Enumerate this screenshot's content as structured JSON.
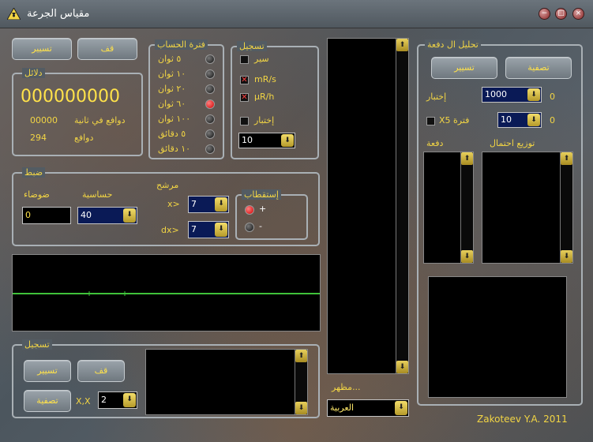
{
  "window": {
    "title": "مقياس الجرعة",
    "min": "−",
    "max": "□",
    "close": "×"
  },
  "top": {
    "reset": "تسيير",
    "stop": "قف"
  },
  "counter": {
    "title": "دلائل",
    "value": "000000000",
    "cps_value": "00000",
    "cps_label": "دوافع في ثانية",
    "pulses_value": "294",
    "pulses_label": "دوافع"
  },
  "period": {
    "title": "فترة الحساب",
    "items": [
      {
        "label": "٥ ثوان",
        "on": false
      },
      {
        "label": "١٠ ثوان",
        "on": false
      },
      {
        "label": "٢٠ ثوان",
        "on": false
      },
      {
        "label": "٦٠ ثوان",
        "on": true
      },
      {
        "label": "١٠٠ ثوان",
        "on": false
      },
      {
        "label": "٥ دقائق",
        "on": false
      },
      {
        "label": "١٠ دقائق",
        "on": false
      }
    ]
  },
  "record": {
    "title": "تسجيل",
    "items": [
      {
        "label": "سير",
        "checked": false
      },
      {
        "label": "mR/s",
        "checked": true
      },
      {
        "label": "µR/h",
        "checked": true
      },
      {
        "label": "إختبار",
        "checked": false
      }
    ],
    "combo": "10"
  },
  "adjust": {
    "title": "ضبط",
    "noise_label": "ضوضاء",
    "noise_value": "0",
    "sens_label": "حساسية",
    "sens_value": "40",
    "filter_label": "مرشح",
    "x_label": "x>",
    "x_value": "7",
    "dx_label": "dx>",
    "dx_value": "7"
  },
  "polarity": {
    "title": "إستقطاب",
    "plus": "+",
    "minus": "-"
  },
  "rec2": {
    "title": "تسجيل",
    "reset": "تسيير",
    "stop": "قف",
    "clear": "تصفية",
    "xx_label": "X,X",
    "combo": "2"
  },
  "appearance": {
    "label": "مظهر...",
    "lang": "العربية"
  },
  "analysis": {
    "title": "تحليل ال دفعة",
    "reset": "تسيير",
    "clear": "تصفية",
    "test_label": "إختبار",
    "test_value": "1000",
    "test_zero": "0",
    "period_label": "X5 فترة",
    "period_value": "10",
    "period_zero": "0",
    "batch_label": "دفعة",
    "dist_label": "توزيع احتمال"
  },
  "footer": "Zakoteev Y.A. 2011",
  "colors": {
    "accent": "#f2d544",
    "dose": "#ffe24a",
    "trace": "#3fc23a",
    "marker": "#d00000"
  }
}
